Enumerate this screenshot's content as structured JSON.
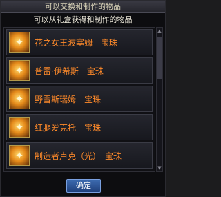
{
  "window": {
    "title": "可以交换和制作的物品",
    "subtitle": "可以从礼盒获得和制作的物品"
  },
  "items": [
    {
      "label": "花之女王波塞姆　宝珠",
      "icon": "orb-icon"
    },
    {
      "label": "普雷·伊希斯　宝珠",
      "icon": "orb-icon"
    },
    {
      "label": "野雪斯瑞姆　宝珠",
      "icon": "orb-icon"
    },
    {
      "label": "红腿爱克托　宝珠",
      "icon": "orb-icon"
    },
    {
      "label": "制造者卢克（光）　宝珠",
      "icon": "orb-icon"
    }
  ],
  "buttons": {
    "confirm": "确定"
  },
  "colors": {
    "item_text": "#ff8a2a",
    "confirm_bg": "#2a5298"
  }
}
